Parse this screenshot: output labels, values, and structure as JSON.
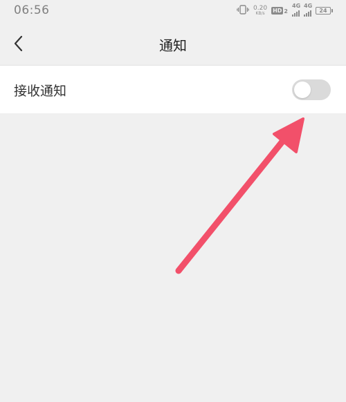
{
  "status_bar": {
    "time": "06:56",
    "net_speed_value": "0.20",
    "net_speed_unit": "KB/s",
    "hd_label": "HD",
    "hd_sub": "2",
    "signal1_label": "4G",
    "signal2_label": "4G",
    "battery_level": "24"
  },
  "nav": {
    "title": "通知"
  },
  "settings": {
    "receive_notifications_label": "接收通知",
    "receive_notifications_enabled": false
  },
  "colors": {
    "accent_arrow": "#f2506a",
    "toggle_off": "#dadada",
    "background": "#f0f0f0"
  }
}
